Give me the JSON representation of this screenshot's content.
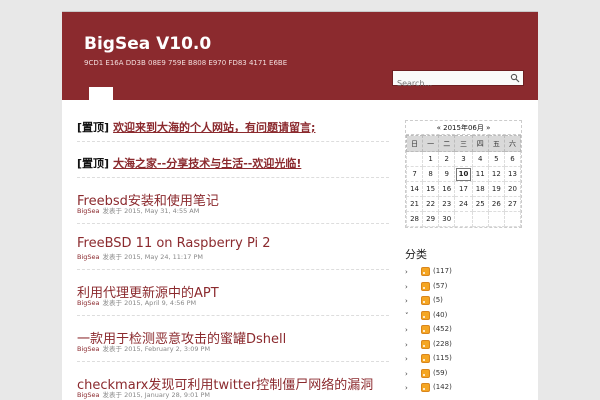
{
  "site": {
    "title": "BigSea V10.0",
    "tagline": "9CD1 E16A DD3B 08E9 759E B808 E970 FD83 4171 E6BE"
  },
  "search": {
    "placeholder": "Search..."
  },
  "sticky_posts": [
    {
      "tag": "[置顶]",
      "title": "欢迎来到大海的个人网站，有问题请留言;"
    },
    {
      "tag": "[置顶]",
      "title": "大海之家--分享技术与生活--欢迎光临!"
    }
  ],
  "posts": [
    {
      "title": "Freebsd安装和使用笔记",
      "author": "BigSea",
      "date": "发表于 2015, May 31, 4:55 AM"
    },
    {
      "title": "FreeBSD 11 on Raspberry Pi 2",
      "author": "BigSea",
      "date": "发表于 2015, May 24, 11:17 PM"
    },
    {
      "title": "利用代理更新源中的APT",
      "author": "BigSea",
      "date": "发表于 2015, April 9, 4:56 PM"
    },
    {
      "title": "一款用于检测恶意攻击的蜜罐Dshell",
      "author": "BigSea",
      "date": "发表于 2015, February 2, 3:09 PM"
    },
    {
      "title": "checkmarx发现可利用twitter控制僵尸网络的漏洞",
      "author": "BigSea",
      "date": "发表于 2015, January 28, 9:01 PM"
    }
  ],
  "calendar": {
    "header": "« 2015年06月 »",
    "weekdays": [
      "日",
      "一",
      "二",
      "三",
      "四",
      "五",
      "六"
    ],
    "weeks": [
      [
        "",
        "1",
        "2",
        "3",
        "4",
        "5",
        "6"
      ],
      [
        "7",
        "8",
        "9",
        "10",
        "11",
        "12",
        "13"
      ],
      [
        "14",
        "15",
        "16",
        "17",
        "18",
        "19",
        "20"
      ],
      [
        "21",
        "22",
        "23",
        "24",
        "25",
        "26",
        "27"
      ],
      [
        "28",
        "29",
        "30",
        "",
        "",
        "",
        ""
      ]
    ],
    "today": "10"
  },
  "categories": {
    "title": "分类",
    "items": [
      {
        "bullet": "›",
        "count": "(117)"
      },
      {
        "bullet": "›",
        "count": "(57)"
      },
      {
        "bullet": "›",
        "count": "(5)"
      },
      {
        "bullet": "˅",
        "count": "(40)"
      },
      {
        "bullet": "›",
        "count": "(452)"
      },
      {
        "bullet": "›",
        "count": "(228)"
      },
      {
        "bullet": "›",
        "count": "(115)"
      },
      {
        "bullet": "›",
        "count": "(59)"
      },
      {
        "bullet": "›",
        "count": "(142)"
      }
    ]
  },
  "colors": {
    "brand": "#8b2a2e",
    "rss": "#f5a623"
  }
}
